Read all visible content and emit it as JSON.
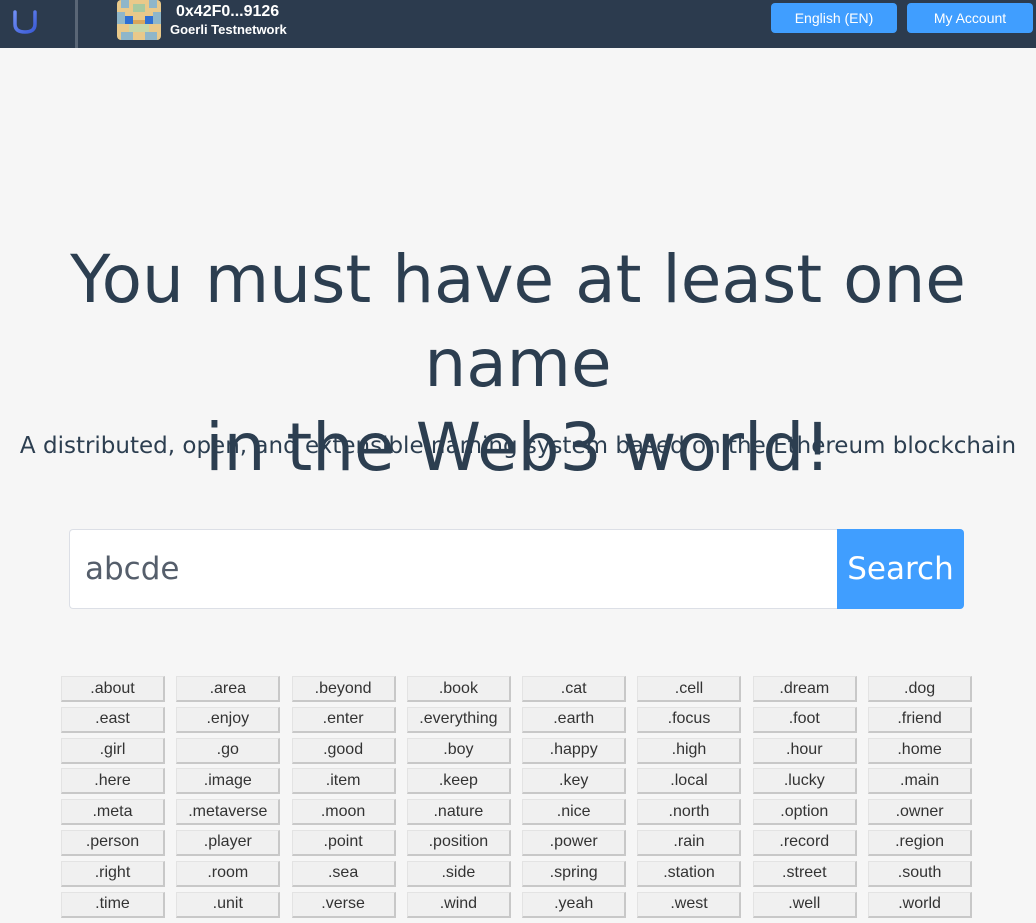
{
  "header": {
    "logo_icon": "u-letter-logo-icon",
    "avatar_icon": "pixel-avatar-icon",
    "address": "0x42F0...9126",
    "network": "Goerli Testnetwork",
    "language_button": "English (EN)",
    "account_button": "My Account",
    "accent_color": "#409eff",
    "bar_color": "#2c3b4e"
  },
  "hero": {
    "title_line1": "You must have at least one name",
    "title_line2": "in the Web3 world!",
    "subtitle": "A distributed, open, and extensible naming system based on the Ethereum blockchain"
  },
  "search": {
    "value": "abcde",
    "button_label": "Search"
  },
  "suffixes": [
    ".about",
    ".area",
    ".beyond",
    ".book",
    ".cat",
    ".cell",
    ".dream",
    ".dog",
    ".east",
    ".enjoy",
    ".enter",
    ".everything",
    ".earth",
    ".focus",
    ".foot",
    ".friend",
    ".girl",
    ".go",
    ".good",
    ".boy",
    ".happy",
    ".high",
    ".hour",
    ".home",
    ".here",
    ".image",
    ".item",
    ".keep",
    ".key",
    ".local",
    ".lucky",
    ".main",
    ".meta",
    ".metaverse",
    ".moon",
    ".nature",
    ".nice",
    ".north",
    ".option",
    ".owner",
    ".person",
    ".player",
    ".point",
    ".position",
    ".power",
    ".rain",
    ".record",
    ".region",
    ".right",
    ".room",
    ".sea",
    ".side",
    ".spring",
    ".station",
    ".street",
    ".south",
    ".time",
    ".unit",
    ".verse",
    ".wind",
    ".yeah",
    ".west",
    ".well",
    ".world"
  ]
}
